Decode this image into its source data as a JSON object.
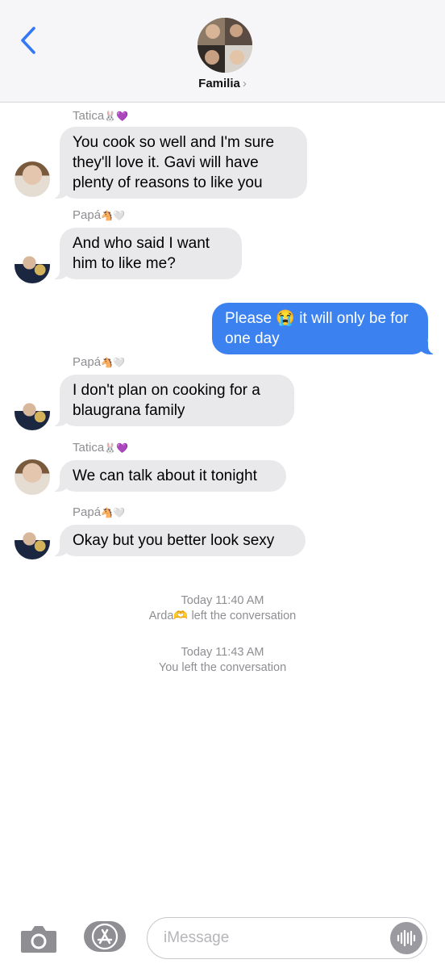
{
  "header": {
    "back_icon": "chevron-left-icon",
    "group_name": "Familia",
    "chevron": "›"
  },
  "messages": [
    {
      "sender": "Tatica",
      "sender_emoji": "🐰💜",
      "text": "You cook so well and I'm sure they'll love it. Gavi will have plenty of reasons to like you",
      "direction": "in"
    },
    {
      "sender": "Papá",
      "sender_emoji": "🐴🤍",
      "text": "And who said I want him to like me?",
      "direction": "in"
    },
    {
      "text": "Please 😭 it will only be for one day",
      "direction": "out"
    },
    {
      "sender": "Papá",
      "sender_emoji": "🐴🤍",
      "text": "I don't plan on cooking for a blaugrana family",
      "direction": "in"
    },
    {
      "sender": "Tatica",
      "sender_emoji": "🐰💜",
      "text": "We can talk about it tonight",
      "direction": "in"
    },
    {
      "sender": "Papá",
      "sender_emoji": "🐴🤍",
      "text": "Okay but you better look sexy",
      "direction": "in"
    }
  ],
  "system": [
    {
      "time": "Today 11:40 AM",
      "text": "Arda🫶 left the conversation"
    },
    {
      "time": "Today 11:43 AM",
      "text": "You left the conversation"
    }
  ],
  "composer": {
    "placeholder": "iMessage",
    "camera_icon": "camera-icon",
    "apps_icon": "app-store-icon",
    "audio_icon": "audio-waveform-icon"
  },
  "colors": {
    "outgoing_bubble": "#3b82f0",
    "incoming_bubble": "#e9e9eb",
    "header_bg": "#f6f6f8",
    "link_blue": "#3478f6"
  }
}
